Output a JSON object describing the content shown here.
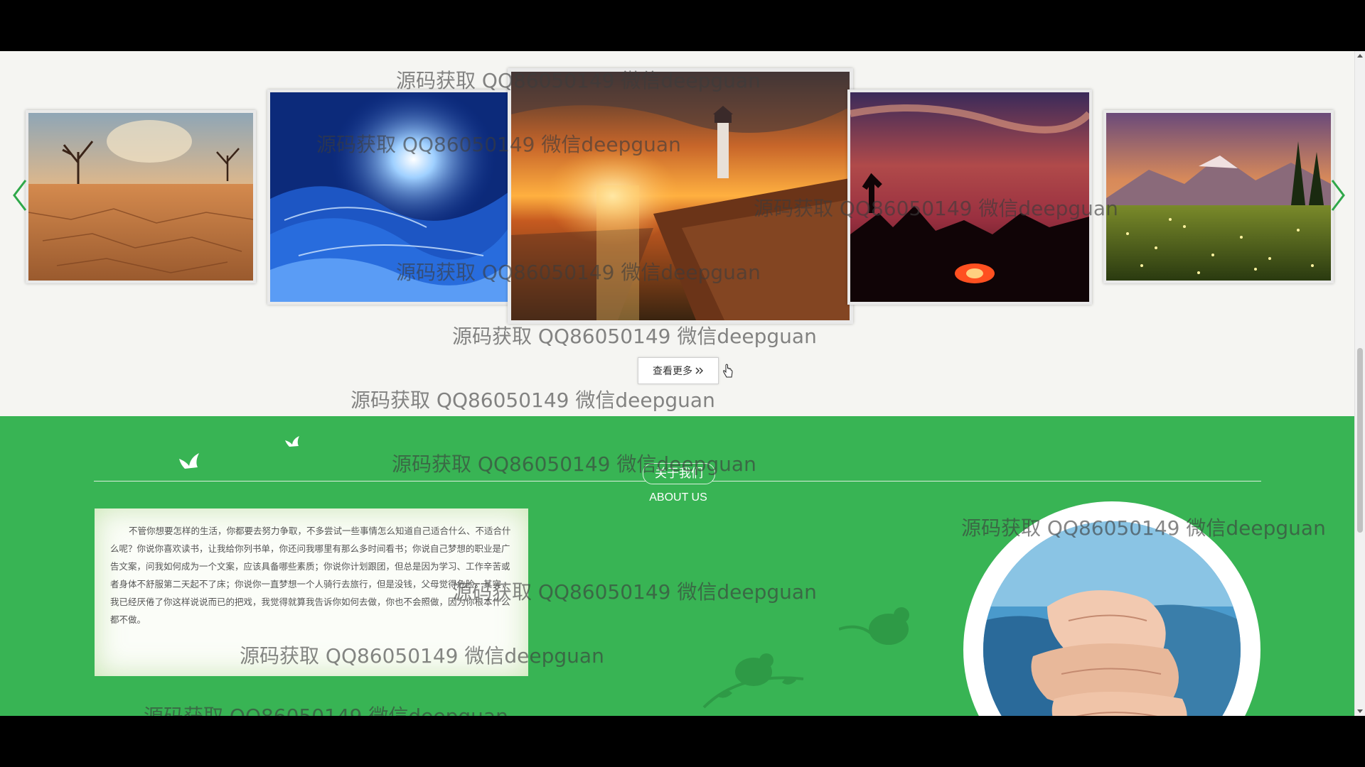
{
  "gallery": {
    "slides": [
      {
        "name": "desert-cracked-earth"
      },
      {
        "name": "blue-ice-waves"
      },
      {
        "name": "lighthouse-sunset"
      },
      {
        "name": "red-sunset-trees"
      },
      {
        "name": "mountain-meadow"
      }
    ],
    "more_button_label": "查看更多",
    "more_button_icon": "double-chevron-right-icon",
    "prev_icon": "chevron-left-icon",
    "next_icon": "chevron-right-icon",
    "accent_color": "#2fa84a"
  },
  "about": {
    "title": "关于我们",
    "subtitle": "ABOUT US",
    "paragraph": "不管你想要怎样的生活，你都要去努力争取，不多尝试一些事情怎么知道自己适合什么、不适合什么呢？你说你喜欢读书，让我给你列书单，你还问我哪里有那么多时间看书；你说自己梦想的职业是广告文案，问我如何成为一个文案，应该具备哪些素质；你说你计划跟团，但总是因为学习、工作辛苦或者身体不舒服第二天起不了床；你说你一直梦想一个人骑行去旅行，但是没钱，父母觉得危险。其实，我已经厌倦了你这样说说而已的把戏，我觉得就算我告诉你如何去做，你也不会照做，因为你根本什么都不做。",
    "background_color": "#38b454"
  },
  "watermark": {
    "text": "源码获取 QQ86050149 微信deepguan"
  }
}
